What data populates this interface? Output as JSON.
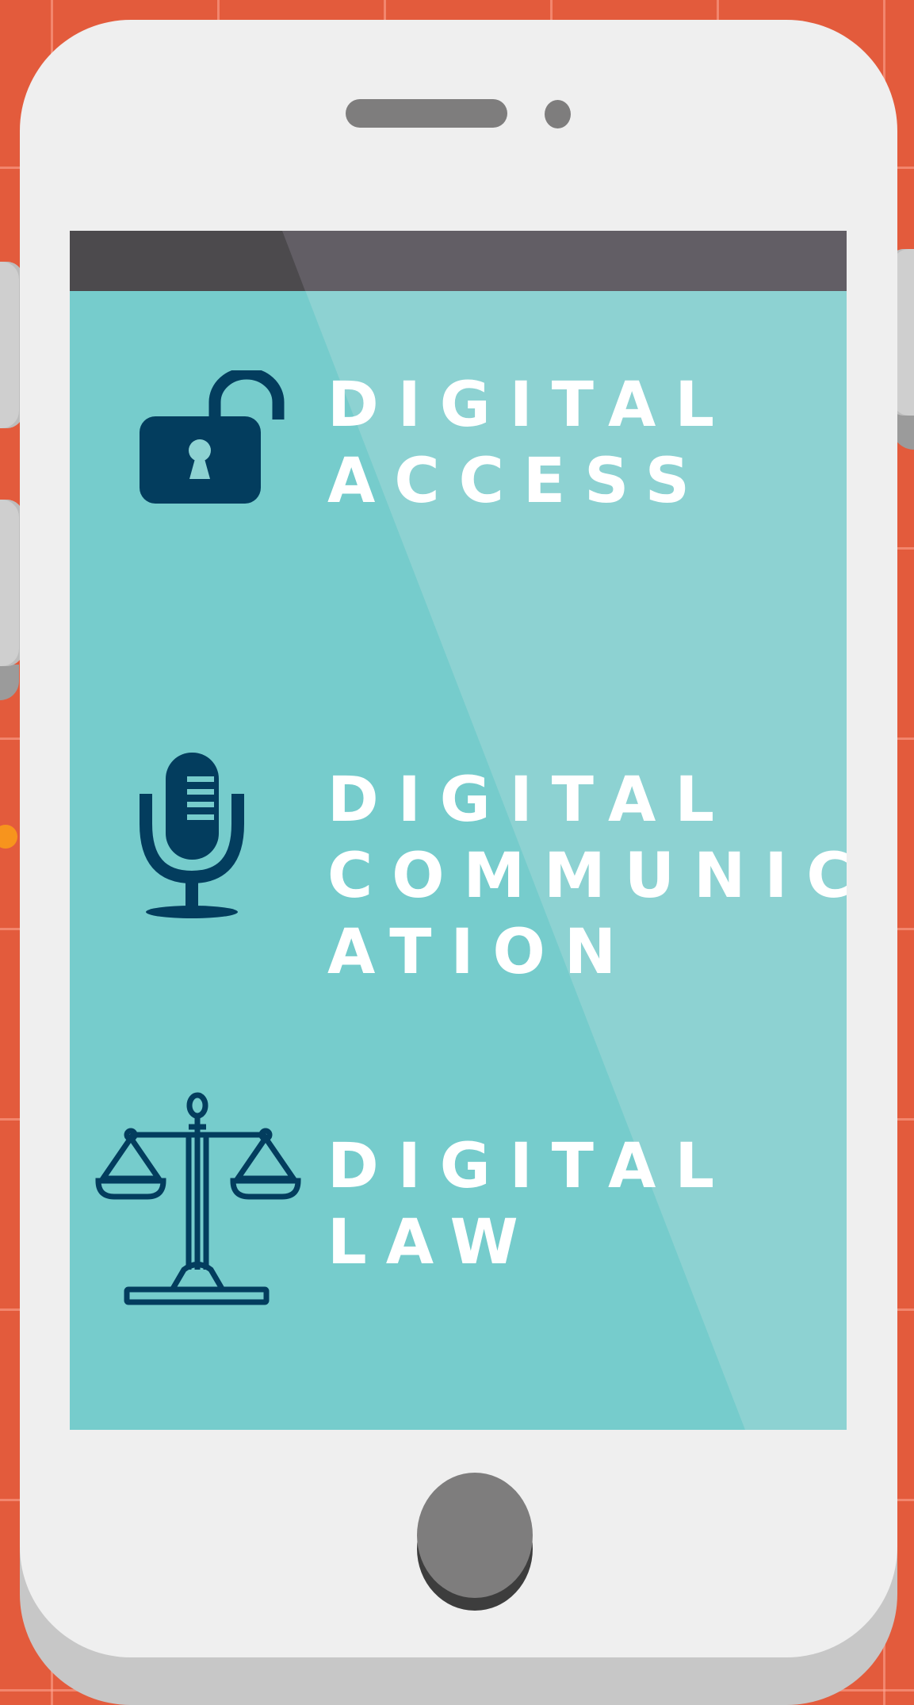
{
  "screen": {
    "items": [
      {
        "icon": "unlocked-padlock-icon",
        "line1": "Digital",
        "line2": "Access",
        "line3": ""
      },
      {
        "icon": "microphone-icon",
        "line1": "Digital",
        "line2": "Communic",
        "line3": "ation"
      },
      {
        "icon": "scales-of-justice-icon",
        "line1": "Digital",
        "line2": "Law",
        "line3": ""
      }
    ]
  },
  "colors": {
    "background": "#e35b3c",
    "screen": "#76cccc",
    "screen_highlight": "#8dd2d2",
    "status_bar": "#625e65",
    "icon": "#033d5e",
    "text": "#ffffff",
    "phone_body": "#efefef"
  }
}
